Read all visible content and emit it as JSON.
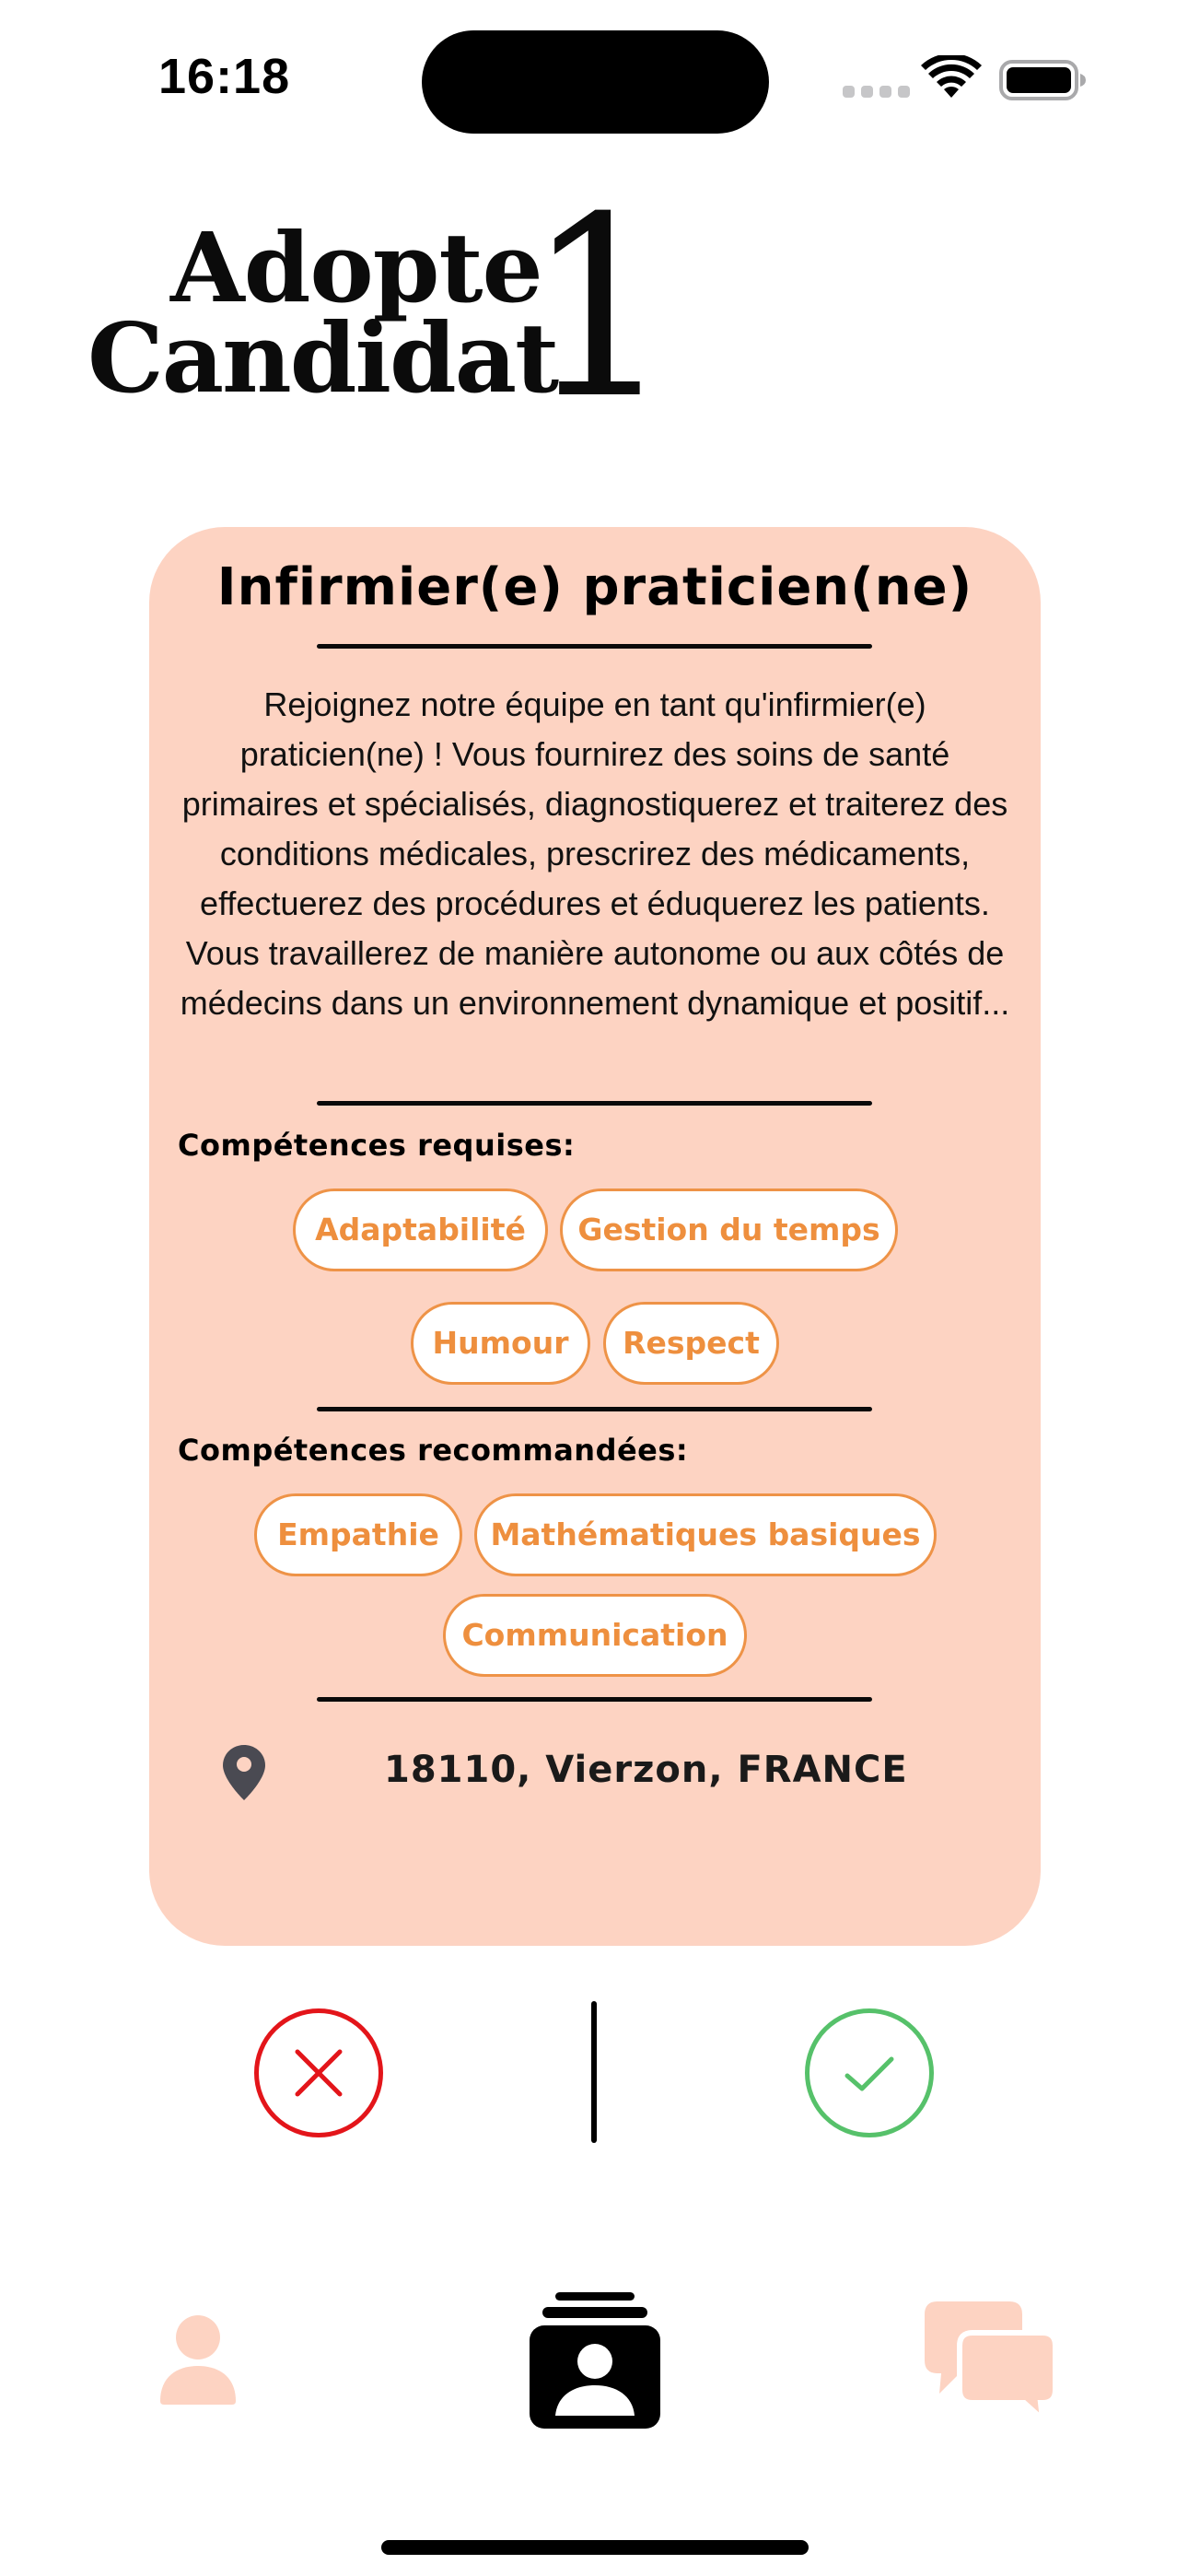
{
  "status_bar": {
    "time": "16:18"
  },
  "logo": {
    "line1": "Adopte",
    "line2": "Candidat",
    "digit": "1"
  },
  "job_card": {
    "title": "Infirmier(e) praticien(ne)",
    "description": "Rejoignez notre équipe en tant qu'infirmier(e) praticien(ne) ! Vous fournirez des soins de santé primaires et spécialisés, diagnostiquerez et traiterez des conditions médicales, prescrirez des médicaments, effectuerez des procédures et éduquerez les patients. Vous travaillerez de manière autonome ou aux côtés de médecins dans un environnement dynamique et positif...",
    "required_skills_label": "Compétences requises:",
    "required_skills": [
      "Adaptabilité",
      "Gestion du temps",
      "Humour",
      "Respect"
    ],
    "recommended_skills_label": "Compétences recommandées:",
    "recommended_skills": [
      "Empathie",
      "Mathématiques basiques",
      "Communication"
    ],
    "location": "18110, Vierzon, FRANCE",
    "location_icon": "map-pin-icon"
  },
  "actions": {
    "reject_icon": "close-icon",
    "accept_icon": "checkmark-icon"
  },
  "tab_bar": {
    "items": [
      {
        "icon": "person-icon",
        "active": false
      },
      {
        "icon": "candidate-cards-icon",
        "active": true
      },
      {
        "icon": "chat-bubbles-icon",
        "active": false
      }
    ]
  },
  "colors": {
    "card_background": "#fdd3c2",
    "chip_accent": "#ee8f3e",
    "reject": "#e3151a",
    "accept": "#56c16a",
    "tab_inactive": "#fdd3c2",
    "tab_active": "#000000"
  }
}
